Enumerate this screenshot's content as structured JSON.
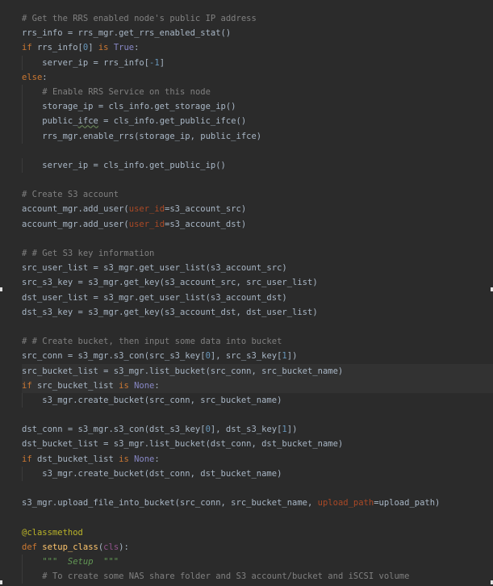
{
  "editor": {
    "lines": [
      [
        {
          "t": "# Get the RRS enabled node's public IP address",
          "c": "comment"
        }
      ],
      [
        {
          "t": "rrs_info = rrs_mgr.get_rrs_enabled_stat()"
        }
      ],
      [
        {
          "t": "if ",
          "c": "kw"
        },
        {
          "t": "rrs_info["
        },
        {
          "t": "0",
          "c": "num"
        },
        {
          "t": "] "
        },
        {
          "t": "is ",
          "c": "kw"
        },
        {
          "t": "True",
          "c": "const"
        },
        {
          "t": ":"
        }
      ],
      [
        {
          "t": "    server_ip = rrs_info["
        },
        {
          "t": "-1",
          "c": "num"
        },
        {
          "t": "]"
        }
      ],
      [
        {
          "t": "else",
          "c": "kw"
        },
        {
          "t": ":"
        }
      ],
      [
        {
          "t": "    "
        },
        {
          "t": "# Enable RRS Service on this node",
          "c": "comment"
        }
      ],
      [
        {
          "t": "    storage_ip = cls_info.get_storage_ip()"
        }
      ],
      [
        {
          "t": "    public_"
        },
        {
          "t": "ifce",
          "c": "squiggle"
        },
        {
          "t": " = cls_info.get_public_ifce()"
        }
      ],
      [
        {
          "t": "    rrs_mgr.enable_rrs(storage_ip, public_ifce)"
        }
      ],
      [
        {
          "t": ""
        }
      ],
      [
        {
          "t": "    server_ip = cls_info.get_public_ip()"
        }
      ],
      [
        {
          "t": ""
        }
      ],
      [
        {
          "t": "# Create S3 account",
          "c": "comment"
        }
      ],
      [
        {
          "t": "account_mgr.add_user("
        },
        {
          "t": "user_id",
          "c": "param"
        },
        {
          "t": "=s3_account_src)"
        }
      ],
      [
        {
          "t": "account_mgr.add_user("
        },
        {
          "t": "user_id",
          "c": "param"
        },
        {
          "t": "=s3_account_dst)"
        }
      ],
      [
        {
          "t": ""
        }
      ],
      [
        {
          "t": "# # Get S3 key information",
          "c": "comment"
        }
      ],
      [
        {
          "t": "src_user_list = s3_mgr.get_user_list(s3_account_src)"
        }
      ],
      [
        {
          "t": "src_s3_key = s3_mgr.get_key(s3_account_src, src_user_list)"
        }
      ],
      [
        {
          "t": "dst_user_list = s3_mgr.get_user_list(s3_account_dst)"
        }
      ],
      [
        {
          "t": "dst_s3_key = s3_mgr.get_key(s3_account_dst, dst_user_list)"
        }
      ],
      [
        {
          "t": ""
        }
      ],
      [
        {
          "t": "# # Create bucket, then input some data into bucket",
          "c": "comment"
        }
      ],
      [
        {
          "t": "src_conn = s3_mgr.s3_con(src_s3_key["
        },
        {
          "t": "0",
          "c": "num"
        },
        {
          "t": "], src_s3_key["
        },
        {
          "t": "1",
          "c": "num"
        },
        {
          "t": "])"
        }
      ],
      [
        {
          "t": "src_bucket_list = s3_mgr.list_bucket(src_conn, src_bucket_name)"
        }
      ],
      [
        {
          "t": "if ",
          "c": "kw"
        },
        {
          "t": "src_bucket_list "
        },
        {
          "t": "is ",
          "c": "kw"
        },
        {
          "t": "None",
          "c": "const"
        },
        {
          "t": ":"
        }
      ],
      [
        {
          "t": "    s3_mgr.create_bucket(src_conn, src_bucket_name)"
        }
      ],
      [
        {
          "t": ""
        }
      ],
      [
        {
          "t": "dst_conn = s3_mgr.s3_con(dst_s3_key["
        },
        {
          "t": "0",
          "c": "num"
        },
        {
          "t": "], dst_s3_key["
        },
        {
          "t": "1",
          "c": "num"
        },
        {
          "t": "])"
        }
      ],
      [
        {
          "t": "dst_bucket_list = s3_mgr.list_bucket(dst_conn, dst_bucket_name)"
        }
      ],
      [
        {
          "t": "if ",
          "c": "kw"
        },
        {
          "t": "dst_bucket_list "
        },
        {
          "t": "is ",
          "c": "kw"
        },
        {
          "t": "None",
          "c": "const"
        },
        {
          "t": ":"
        }
      ],
      [
        {
          "t": "    s3_mgr.create_bucket(dst_conn, dst_bucket_name)"
        }
      ],
      [
        {
          "t": ""
        }
      ],
      [
        {
          "t": "s3_mgr.upload_file_into_bucket(src_conn, src_bucket_name, "
        },
        {
          "t": "upload_path",
          "c": "param"
        },
        {
          "t": "=upload_path)"
        }
      ],
      [
        {
          "t": ""
        }
      ],
      [
        {
          "t": "@classmethod",
          "c": "deco"
        }
      ],
      [
        {
          "t": "def ",
          "c": "kw"
        },
        {
          "t": "setup_class",
          "c": "fname"
        },
        {
          "t": "("
        },
        {
          "t": "cls",
          "c": "cls"
        },
        {
          "t": "):"
        }
      ],
      [
        {
          "t": "    "
        },
        {
          "t": "\"\"\"  Setup  \"\"\"",
          "c": "docstr"
        }
      ],
      [
        {
          "t": "    "
        },
        {
          "t": "# To create some NAS share folder and S3 account/bucket and iSCSI volume",
          "c": "comment"
        }
      ]
    ]
  }
}
